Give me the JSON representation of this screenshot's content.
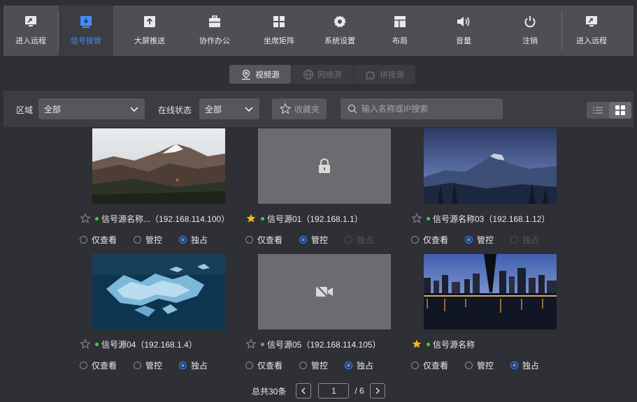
{
  "nav": {
    "items": [
      {
        "label": "进入远程",
        "icon": "remote-icon"
      },
      {
        "label": "信号接管",
        "icon": "download-icon",
        "active": true
      },
      {
        "label": "大屏推送",
        "icon": "push-screen-icon"
      },
      {
        "label": "协作办公",
        "icon": "briefcase-icon"
      },
      {
        "label": "坐席矩阵",
        "icon": "grid-icon"
      },
      {
        "label": "系统设置",
        "icon": "gear-icon"
      },
      {
        "label": "布局",
        "icon": "layout-icon"
      },
      {
        "label": "音量",
        "icon": "volume-icon"
      },
      {
        "label": "注销",
        "icon": "power-icon"
      },
      {
        "label": "进入远程",
        "icon": "remote-icon"
      }
    ]
  },
  "tabs": [
    {
      "label": "视频源",
      "icon": "location-pin-icon",
      "active": true
    },
    {
      "label": "网络源",
      "icon": "globe-icon"
    },
    {
      "label": "拼接源",
      "icon": "puzzle-icon"
    }
  ],
  "filters": {
    "region_label": "区域",
    "region_value": "全部",
    "status_label": "在线状态",
    "status_value": "全部",
    "favorites_label": "收藏夹",
    "search_placeholder": "输入名称或IP搜索"
  },
  "radio_labels": {
    "view": "仅查看",
    "control": "管控",
    "exclusive": "独占"
  },
  "sources": [
    {
      "name": "信号源名称...（192.168.114.100）",
      "starred": false,
      "online": true,
      "thumb": "mountains",
      "selected": "exclusive",
      "disabled": []
    },
    {
      "name": "信号源01（192.168.1.1）",
      "starred": true,
      "online": true,
      "thumb": "locked",
      "selected": "control",
      "disabled": [
        "exclusive"
      ]
    },
    {
      "name": "信号源名称03（192.168.1.12）",
      "starred": false,
      "online": true,
      "thumb": "half-dome",
      "selected": "control",
      "disabled": [
        "exclusive"
      ]
    },
    {
      "name": "信号源04（192.168.1.4）",
      "starred": false,
      "online": true,
      "thumb": "ice",
      "selected": "exclusive",
      "disabled": []
    },
    {
      "name": "信号源05（192.168.114.105）",
      "starred": false,
      "online": false,
      "thumb": "no-video",
      "selected": "exclusive",
      "disabled": []
    },
    {
      "name": "信号源名称",
      "starred": true,
      "online": true,
      "thumb": "city-night",
      "selected": "exclusive",
      "disabled": []
    }
  ],
  "pagination": {
    "total": "总共30条",
    "current": "1",
    "pages": "/ 6"
  },
  "colors": {
    "accent": "#3f8dff",
    "online": "#3ecf4a",
    "offline": "#8a8c91",
    "star": "#f5b51e"
  }
}
